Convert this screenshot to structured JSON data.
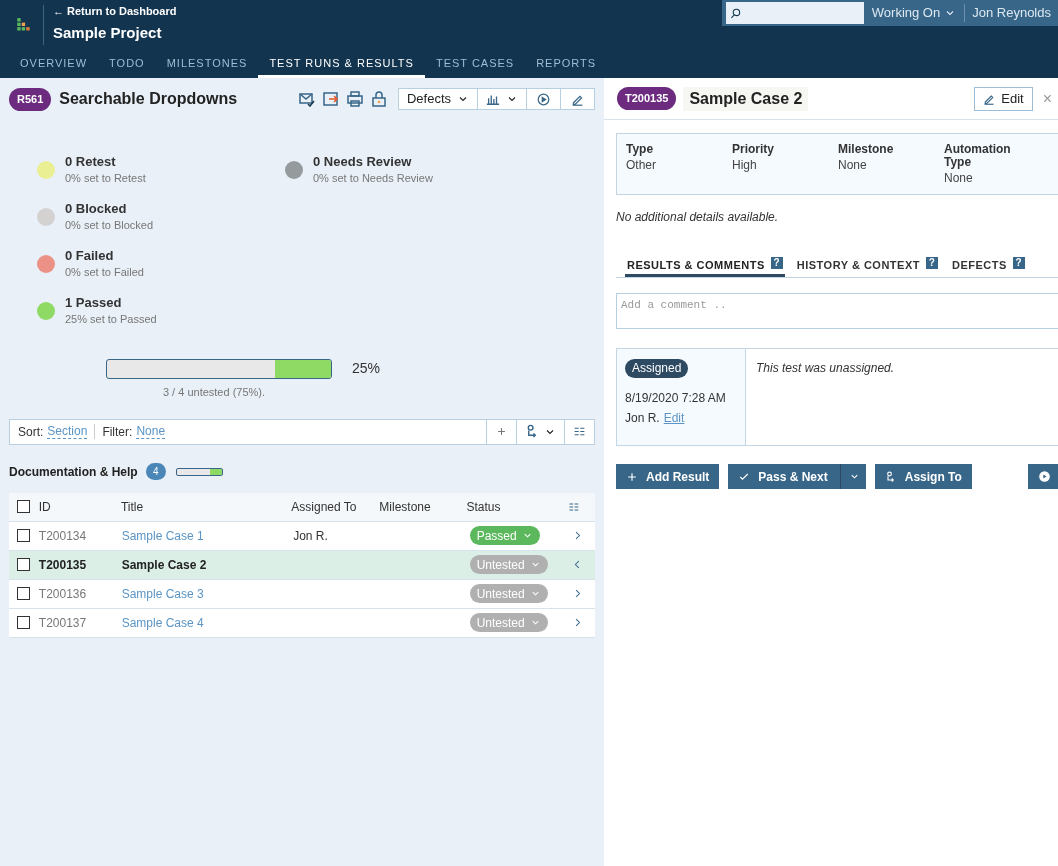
{
  "header": {
    "back_link": "← Return to Dashboard",
    "project_title": "Sample Project",
    "working_on": "Working On",
    "user": "Jon Reynolds"
  },
  "nav_tabs": [
    {
      "label": "OVERVIEW",
      "selected": false
    },
    {
      "label": "TODO",
      "selected": false
    },
    {
      "label": "MILESTONES",
      "selected": false
    },
    {
      "label": "TEST RUNS & RESULTS",
      "selected": true
    },
    {
      "label": "TEST CASES",
      "selected": false
    },
    {
      "label": "REPORTS",
      "selected": false
    }
  ],
  "run": {
    "badge": "R561",
    "title": "Searchable Dropdowns",
    "defects_label": "Defects"
  },
  "stats_columns": [
    [
      {
        "count_label": "0 Retest",
        "subtitle": "0% set to Retest",
        "color": "#eaef94"
      },
      {
        "count_label": "0 Blocked",
        "subtitle": "0% set to Blocked",
        "color": "#d4d2d1"
      },
      {
        "count_label": "0 Failed",
        "subtitle": "0% set to Failed",
        "color": "#ec9185"
      },
      {
        "count_label": "1 Passed",
        "subtitle": "25% set to Passed",
        "color": "#8fd965"
      }
    ],
    [
      {
        "count_label": "0 Needs Review",
        "subtitle": "0% set to Needs Review",
        "color": "#959a9c"
      }
    ]
  ],
  "progress": {
    "level": 0.25,
    "percent": "25%",
    "caption": "3 / 4 untested (75%)."
  },
  "sort_filter": {
    "sort_label": "Sort:",
    "sort_value": "Section",
    "filter_label": "Filter:",
    "filter_value": "None"
  },
  "section": {
    "title": "Documentation & Help",
    "count": "4",
    "level": 0.25
  },
  "table": {
    "select_all_checked": false,
    "columns": [
      "ID",
      "Title",
      "Assigned To",
      "Milestone",
      "Status"
    ],
    "rows": [
      {
        "id": "T200134",
        "title": "Sample Case 1",
        "assigned_to": "Jon R.",
        "status": "Passed",
        "color": "#5cb85c",
        "checked": false,
        "selected": false
      },
      {
        "id": "T200135",
        "title": "Sample Case 2",
        "status": "Untested",
        "color": "#b0b0b0",
        "checked": false,
        "selected": true
      },
      {
        "id": "T200136",
        "title": "Sample Case 3",
        "status": "Untested",
        "color": "#b0b0b0",
        "checked": false,
        "selected": false
      },
      {
        "id": "T200137",
        "title": "Sample Case 4",
        "status": "Untested",
        "color": "#b0b0b0",
        "checked": false,
        "selected": false
      }
    ]
  },
  "detail": {
    "badge": "T200135",
    "title": "Sample Case 2",
    "edit_label": "Edit",
    "close": "×",
    "fields": [
      {
        "label": "Type",
        "value": "Other"
      },
      {
        "label": "Priority",
        "value": "High"
      },
      {
        "label": "Milestone",
        "value": "None"
      },
      {
        "label": "Automation Type",
        "value": "None"
      }
    ],
    "note": "No additional details available.",
    "tabs": [
      {
        "label": "RESULTS & COMMENTS",
        "selected": true
      },
      {
        "label": "HISTORY & CONTEXT",
        "selected": false
      },
      {
        "label": "DEFECTS",
        "selected": false
      }
    ],
    "help_mark": "?",
    "comment": {
      "placeholder": "Add a comment .."
    },
    "result": {
      "status": "Assigned",
      "date": "8/19/2020 7:28 AM",
      "author": "Jon R.",
      "edit_link": "Edit",
      "message": "This test was unassigned."
    },
    "buttons": [
      {
        "label": "Add Result",
        "kind": "add"
      },
      {
        "label": "Pass & Next",
        "kind": "pass"
      },
      {
        "label": "Assign To",
        "kind": "assign"
      }
    ]
  }
}
